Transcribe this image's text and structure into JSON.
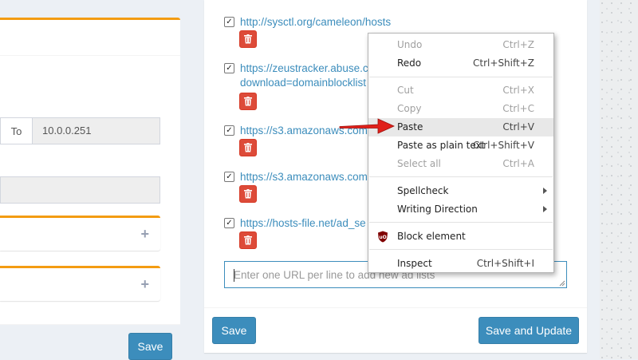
{
  "left_panel": {
    "range_to_label": "To",
    "range_to_value": "10.0.0.251",
    "collapsed_sections": [
      {
        "toggle": "+"
      },
      {
        "toggle": "+"
      }
    ],
    "save_label": "Save"
  },
  "adlists": {
    "items": [
      {
        "url": "http://sysctl.org/cameleon/hosts",
        "checked": true
      },
      {
        "url": "https://zeustracker.abuse.c",
        "url_line2": "download=domainblocklist",
        "checked": true
      },
      {
        "url": "https://s3.amazonaws.com/",
        "checked": true
      },
      {
        "url": "https://s3.amazonaws.com/",
        "checked": true
      },
      {
        "url": "https://hosts-file.net/ad_se",
        "checked": true
      }
    ],
    "check_glyph": "✓",
    "new_list_placeholder": "Enter one URL per line to add new ad lists",
    "save_label": "Save",
    "save_update_label": "Save and Update"
  },
  "context_menu": {
    "items": [
      {
        "label": "Undo",
        "shortcut": "Ctrl+Z",
        "disabled": true
      },
      {
        "label": "Redo",
        "shortcut": "Ctrl+Shift+Z",
        "disabled": false
      },
      {
        "label": "Cut",
        "shortcut": "Ctrl+X",
        "disabled": true
      },
      {
        "label": "Copy",
        "shortcut": "Ctrl+C",
        "disabled": true
      },
      {
        "label": "Paste",
        "shortcut": "Ctrl+V",
        "disabled": false,
        "highlighted": true
      },
      {
        "label": "Paste as plain text",
        "shortcut": "Ctrl+Shift+V",
        "disabled": false
      },
      {
        "label": "Select all",
        "shortcut": "Ctrl+A",
        "disabled": true
      },
      {
        "label": "Spellcheck",
        "submenu": true
      },
      {
        "label": "Writing Direction",
        "submenu": true
      },
      {
        "label": "Block element",
        "icon": "ublock-origin-icon"
      },
      {
        "label": "Inspect",
        "shortcut": "Ctrl+Shift+I"
      }
    ]
  },
  "colors": {
    "accent_blue": "#3c8dbc",
    "warning_orange": "#f39c12",
    "danger_red": "#dd4b39",
    "pointer_arrow": "#e0201a"
  }
}
